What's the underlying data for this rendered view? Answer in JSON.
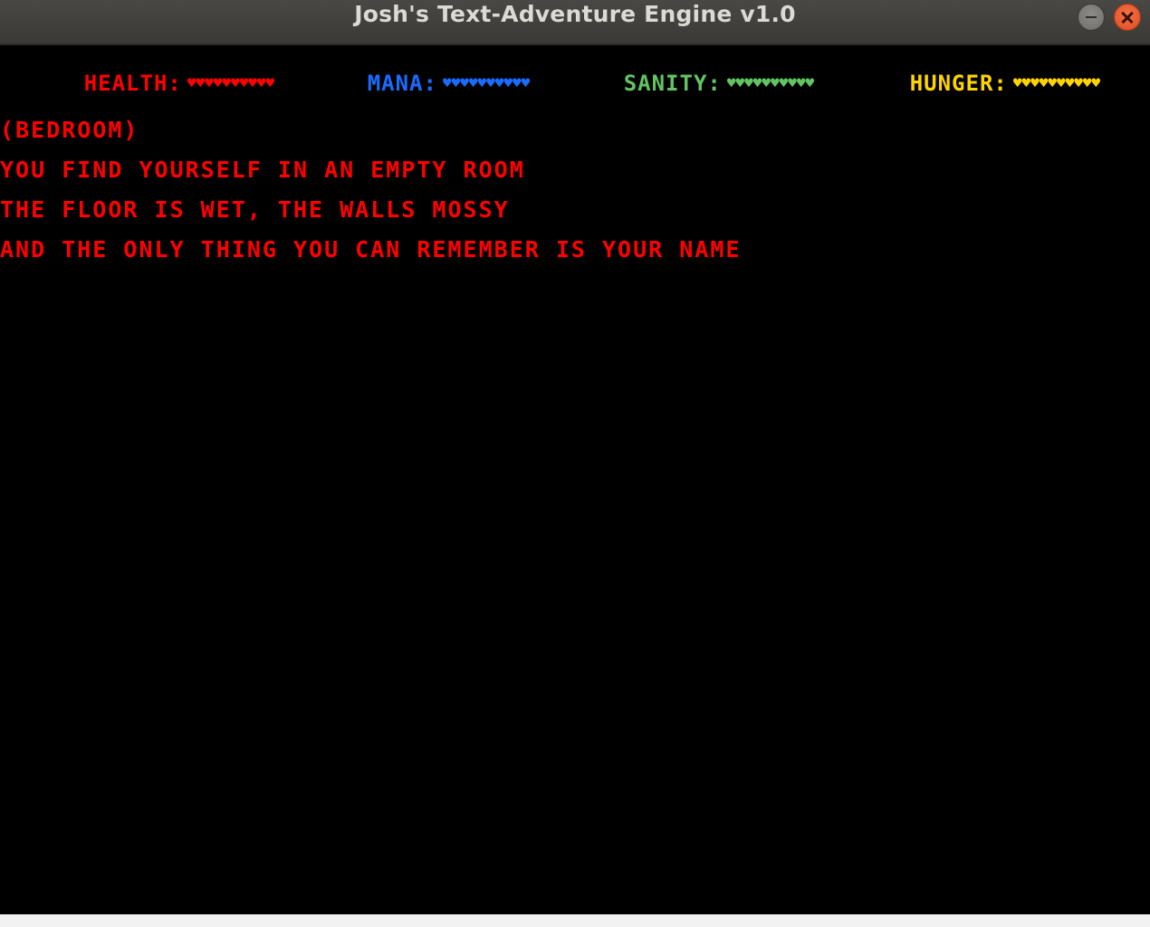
{
  "window": {
    "title": "Josh's Text-Adventure Engine v1.0"
  },
  "stats": {
    "health": {
      "label": "HEALTH:",
      "hearts": "♥♥♥♥♥♥♥♥♥♥",
      "value": 10,
      "max": 10,
      "color": "#ff0000"
    },
    "mana": {
      "label": "MANA:",
      "hearts": "♥♥♥♥♥♥♥♥♥♥",
      "value": 10,
      "max": 10,
      "color": "#1a6cff"
    },
    "sanity": {
      "label": "SANITY:",
      "hearts": "♥♥♥♥♥♥♥♥♥♥",
      "value": 10,
      "max": 10,
      "color": "#62c462"
    },
    "hunger": {
      "label": "HUNGER:",
      "hearts": "♥♥♥♥♥♥♥♥♥♥",
      "value": 10,
      "max": 10,
      "color": "#ffd400"
    }
  },
  "story": {
    "room": "(BEDROOM)",
    "lines": [
      "YOU FIND YOURSELF IN AN EMPTY ROOM",
      "THE FLOOR IS WET, THE WALLS MOSSY",
      "AND THE ONLY THING YOU CAN REMEMBER IS YOUR NAME"
    ],
    "text_color": "#ff0000"
  },
  "icons": {
    "minimize": "minimize-icon",
    "close": "close-icon",
    "heart": "heart-icon"
  }
}
